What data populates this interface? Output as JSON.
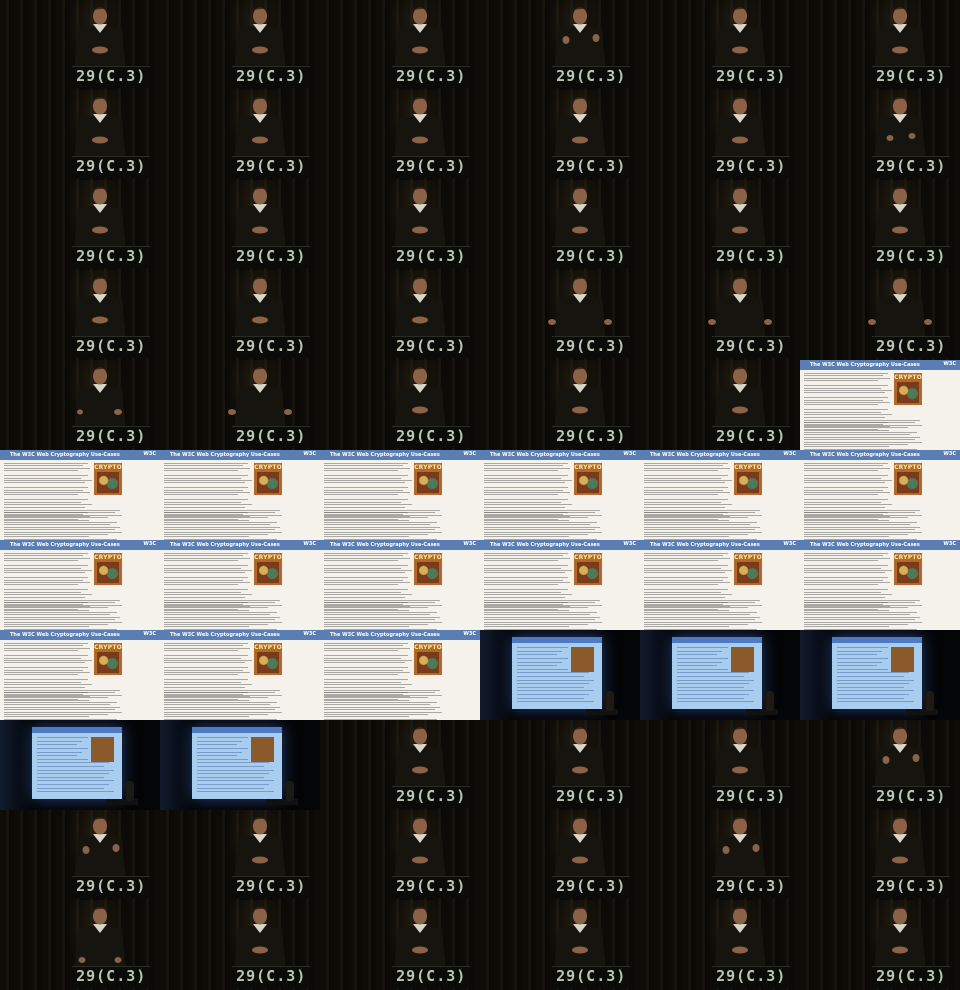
{
  "grid": {
    "columns": 6,
    "rows": 11
  },
  "podium_label": "29(C.3)",
  "slide": {
    "title": "The W3C Web Cryptography Use-Cases",
    "logo": "W3C",
    "crypto_label": "CRYPTO"
  },
  "frames": [
    {
      "type": "speaker",
      "pose": "hands-together"
    },
    {
      "type": "speaker",
      "pose": "hands-together"
    },
    {
      "type": "speaker",
      "pose": "hands-together"
    },
    {
      "type": "speaker",
      "pose": "hands-raised"
    },
    {
      "type": "speaker",
      "pose": "hands-together"
    },
    {
      "type": "speaker",
      "pose": "hands-together"
    },
    {
      "type": "speaker",
      "pose": "hands-together"
    },
    {
      "type": "speaker",
      "pose": "hands-together"
    },
    {
      "type": "speaker",
      "pose": "hands-together"
    },
    {
      "type": "speaker",
      "pose": "hands-together"
    },
    {
      "type": "speaker",
      "pose": "hands-together"
    },
    {
      "type": "speaker",
      "pose": "hands-apart"
    },
    {
      "type": "speaker",
      "pose": "hands-together"
    },
    {
      "type": "speaker",
      "pose": "hands-together"
    },
    {
      "type": "speaker",
      "pose": "hands-together"
    },
    {
      "type": "speaker",
      "pose": "hands-together"
    },
    {
      "type": "speaker",
      "pose": "hands-together"
    },
    {
      "type": "speaker",
      "pose": "hands-together"
    },
    {
      "type": "speaker",
      "pose": "hands-together"
    },
    {
      "type": "speaker",
      "pose": "hands-together"
    },
    {
      "type": "speaker",
      "pose": "hands-together"
    },
    {
      "type": "speaker",
      "pose": "hands-wide"
    },
    {
      "type": "speaker",
      "pose": "hands-wide"
    },
    {
      "type": "speaker",
      "pose": "hands-wide"
    },
    {
      "type": "speaker",
      "pose": "head-tilt"
    },
    {
      "type": "speaker",
      "pose": "hands-wide"
    },
    {
      "type": "speaker",
      "pose": "hands-together"
    },
    {
      "type": "speaker",
      "pose": "hands-together"
    },
    {
      "type": "speaker",
      "pose": "hands-together"
    },
    {
      "type": "slide"
    },
    {
      "type": "slide"
    },
    {
      "type": "slide"
    },
    {
      "type": "slide"
    },
    {
      "type": "slide"
    },
    {
      "type": "slide"
    },
    {
      "type": "slide"
    },
    {
      "type": "slide"
    },
    {
      "type": "slide"
    },
    {
      "type": "slide"
    },
    {
      "type": "slide"
    },
    {
      "type": "slide"
    },
    {
      "type": "slide"
    },
    {
      "type": "slide"
    },
    {
      "type": "slide"
    },
    {
      "type": "slide"
    },
    {
      "type": "wide"
    },
    {
      "type": "wide"
    },
    {
      "type": "wide"
    },
    {
      "type": "wide"
    },
    {
      "type": "wide"
    },
    {
      "type": "speaker",
      "pose": "hands-together"
    },
    {
      "type": "speaker",
      "pose": "hands-together"
    },
    {
      "type": "speaker",
      "pose": "hands-together"
    },
    {
      "type": "speaker",
      "pose": "hands-raised"
    },
    {
      "type": "speaker",
      "pose": "hands-raised"
    },
    {
      "type": "speaker",
      "pose": "hands-together"
    },
    {
      "type": "speaker",
      "pose": "hands-together"
    },
    {
      "type": "speaker",
      "pose": "hands-together"
    },
    {
      "type": "speaker",
      "pose": "hands-raised"
    },
    {
      "type": "speaker",
      "pose": "hands-together"
    },
    {
      "type": "speaker",
      "pose": "hands-down"
    },
    {
      "type": "speaker",
      "pose": "hands-together"
    },
    {
      "type": "speaker",
      "pose": "hands-together"
    },
    {
      "type": "speaker",
      "pose": "hands-together"
    },
    {
      "type": "speaker",
      "pose": "hands-together"
    },
    {
      "type": "speaker",
      "pose": "hands-together"
    }
  ],
  "colors": {
    "background": "#050505",
    "podium_text": "#b9c7b0",
    "slide_header": "#5a7db4",
    "projector_screen": "#a9cdef"
  }
}
